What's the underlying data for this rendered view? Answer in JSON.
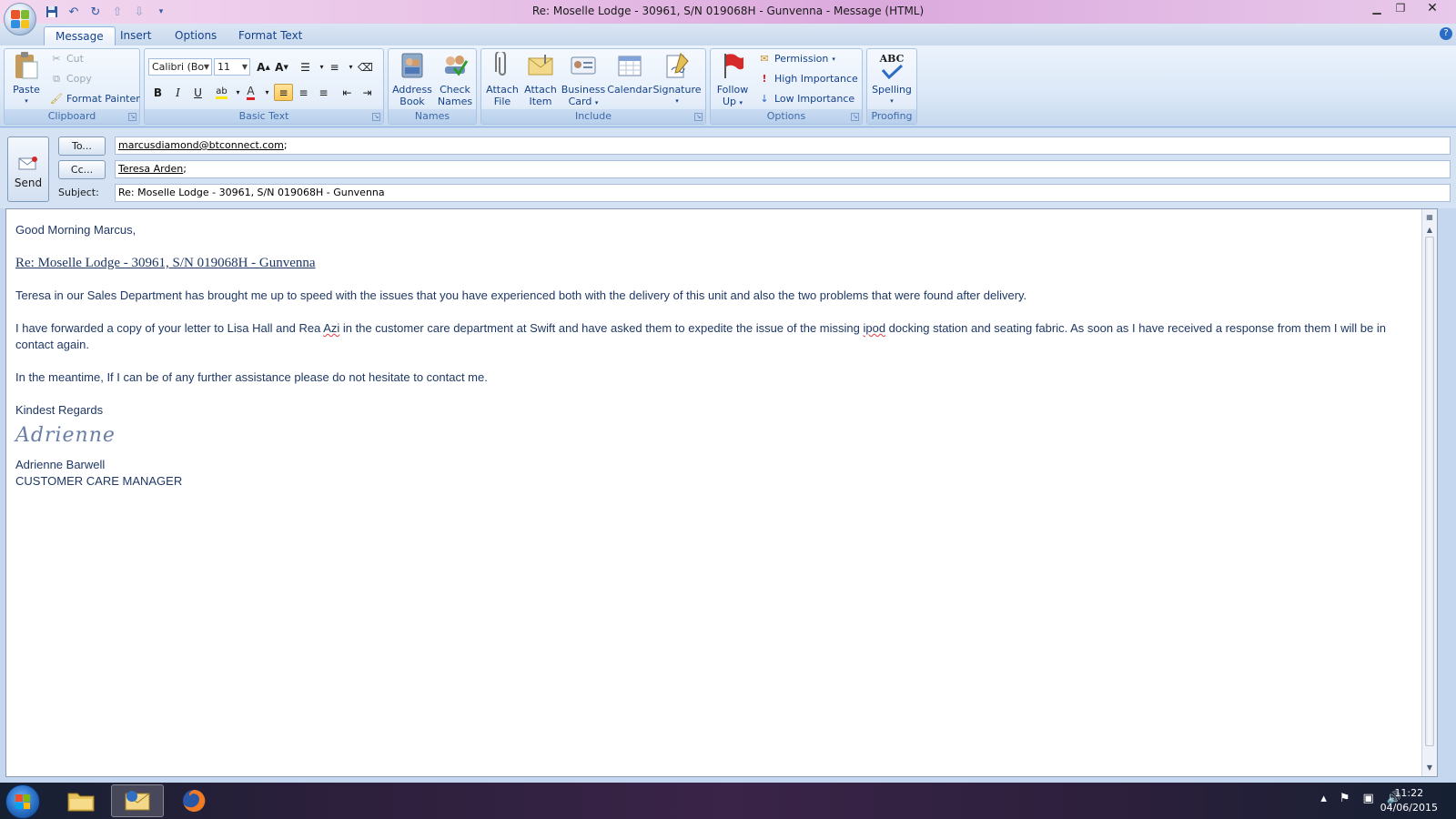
{
  "window": {
    "title": "Re:  Moselle Lodge - 30961, S/N 019068H - Gunvenna - Message (HTML)"
  },
  "tabs": [
    "Message",
    "Insert",
    "Options",
    "Format Text"
  ],
  "ribbon": {
    "clipboard": {
      "label": "Clipboard",
      "paste": "Paste",
      "cut": "Cut",
      "copy": "Copy",
      "format_painter": "Format Painter"
    },
    "basic_text": {
      "label": "Basic Text",
      "font": "Calibri (Bo",
      "size": "11"
    },
    "names": {
      "label": "Names",
      "address_book": [
        "Address",
        "Book"
      ],
      "check_names": [
        "Check",
        "Names"
      ]
    },
    "include": {
      "label": "Include",
      "attach_file": [
        "Attach",
        "File"
      ],
      "attach_item": [
        "Attach",
        "Item"
      ],
      "business_card": [
        "Business",
        "Card"
      ],
      "calendar": "Calendar",
      "signature": "Signature"
    },
    "options": {
      "label": "Options",
      "follow_up": [
        "Follow",
        "Up"
      ],
      "permission": "Permission",
      "high_importance": "High Importance",
      "low_importance": "Low Importance"
    },
    "proofing": {
      "label": "Proofing",
      "spelling": "Spelling",
      "abc": "ABC"
    }
  },
  "header": {
    "send": "Send",
    "to_button": "To...",
    "cc_button": "Cc...",
    "subject_label": "Subject:",
    "to_value": "marcusdiamond@btconnect.com",
    "cc_value": "Teresa Arden",
    "subject_value": "Re:  Moselle Lodge - 30961, S/N 019068H - Gunvenna"
  },
  "message": {
    "greeting": "Good Morning Marcus,",
    "heading": "Re:  Moselle Lodge - 30961, S/N 019068H - Gunvenna",
    "para1": "Teresa in our Sales Department  has brought me up to speed with the issues that you have experienced both with the delivery of this  unit and also the two problems that were found after  delivery.",
    "para2_a": "I have forwarded a copy of your letter to Lisa Hall and Rea ",
    "para2_azi": "Azi",
    "para2_b": " in the customer care department at Swift  and have asked them to expedite the issue of  the missing ",
    "para2_ipod": "ipod",
    "para2_c": " docking station and seating fabric.    As soon as I have received a response from them I will be in contact again.",
    "para3": "In the meantime, If I can be of any further assistance please do not hesitate to contact me.",
    "closing": "Kindest Regards",
    "signature_script": "Adrienne",
    "sig_name": "Adrienne Barwell",
    "sig_title": "CUSTOMER CARE MANAGER"
  },
  "taskbar": {
    "time": "11:22",
    "date": "04/06/2015"
  }
}
